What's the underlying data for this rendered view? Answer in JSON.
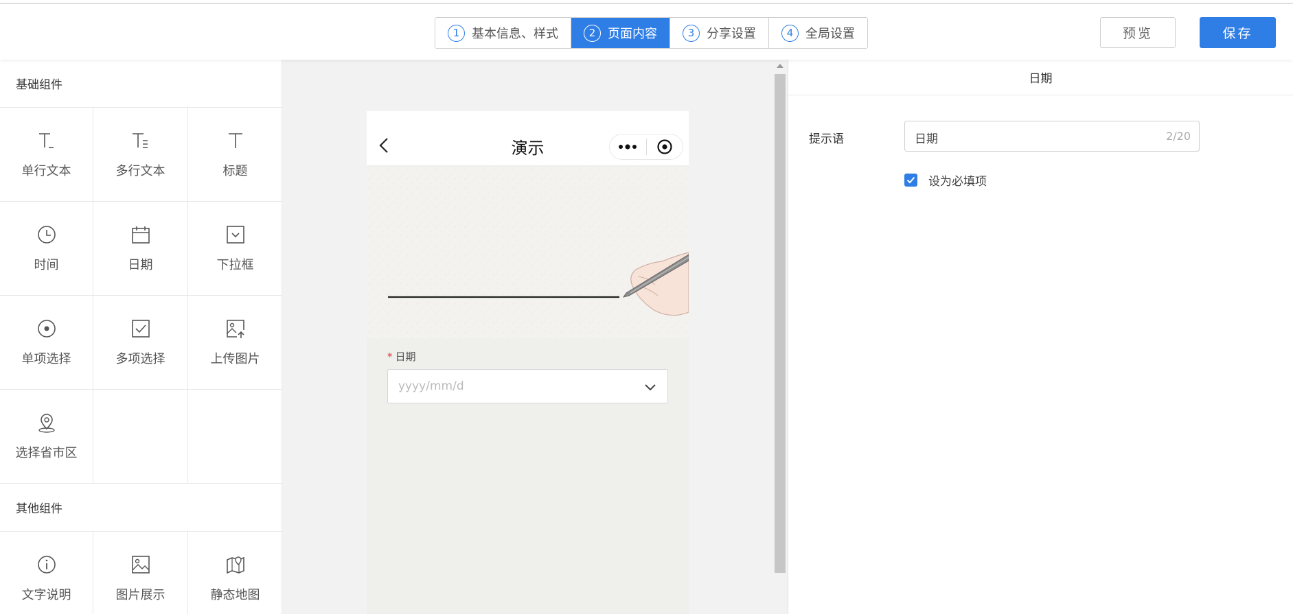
{
  "header": {
    "steps": [
      {
        "num": "1",
        "label": "基本信息、样式"
      },
      {
        "num": "2",
        "label": "页面内容",
        "active": true
      },
      {
        "num": "3",
        "label": "分享设置"
      },
      {
        "num": "4",
        "label": "全局设置"
      }
    ],
    "preview_label": "预览",
    "save_label": "保存"
  },
  "components": {
    "basic_title": "基础组件",
    "basic": [
      {
        "label": "单行文本",
        "icon": "single-line-text-icon"
      },
      {
        "label": "多行文本",
        "icon": "multi-line-text-icon"
      },
      {
        "label": "标题",
        "icon": "title-icon"
      },
      {
        "label": "时间",
        "icon": "clock-icon"
      },
      {
        "label": "日期",
        "icon": "calendar-icon"
      },
      {
        "label": "下拉框",
        "icon": "dropdown-icon"
      },
      {
        "label": "单项选择",
        "icon": "radio-icon"
      },
      {
        "label": "多项选择",
        "icon": "checkbox-icon"
      },
      {
        "label": "上传图片",
        "icon": "upload-image-icon"
      },
      {
        "label": "选择省市区",
        "icon": "location-icon"
      }
    ],
    "other_title": "其他组件",
    "other": [
      {
        "label": "文字说明",
        "icon": "info-icon"
      },
      {
        "label": "图片展示",
        "icon": "image-icon"
      },
      {
        "label": "静态地图",
        "icon": "map-icon"
      }
    ]
  },
  "preview": {
    "nav_title": "演示",
    "field_label": "日期",
    "required_mark": "*",
    "date_placeholder": "yyyy/mm/d"
  },
  "props": {
    "title": "日期",
    "hint_label": "提示语",
    "hint_value": "日期",
    "hint_count": "2/20",
    "required_label": "设为必填项",
    "required_checked": true
  },
  "colors": {
    "accent": "#2f7ee6",
    "required": "#e4393c"
  }
}
